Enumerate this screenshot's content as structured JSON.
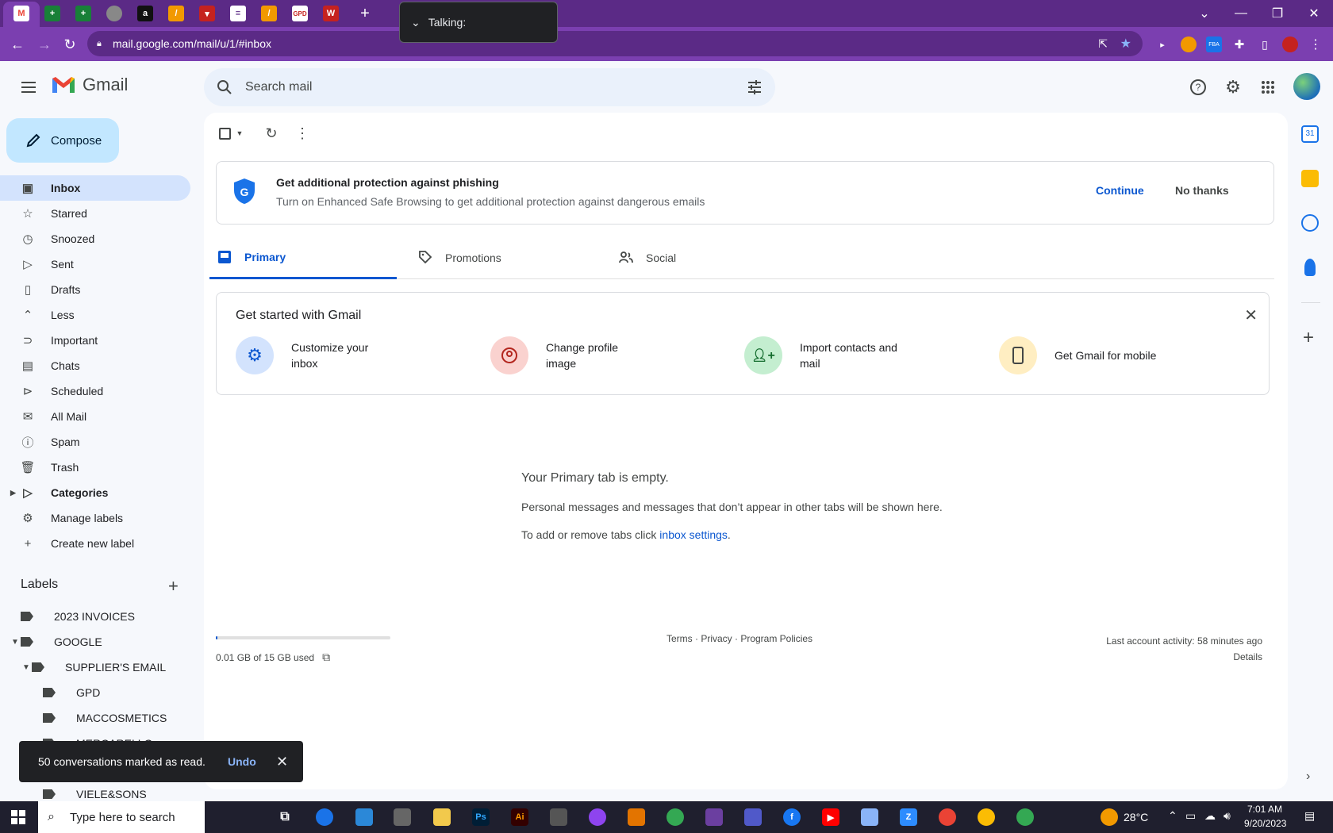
{
  "browser": {
    "url": "mail.google.com/mail/u/1/#inbox",
    "talking_label": "Talking:"
  },
  "header": {
    "app_name": "Gmail",
    "search_placeholder": "Search mail"
  },
  "sidebar": {
    "compose_label": "Compose",
    "items": [
      {
        "label": "Inbox",
        "icon": "inbox-icon"
      },
      {
        "label": "Starred",
        "icon": "star-icon"
      },
      {
        "label": "Snoozed",
        "icon": "clock-icon"
      },
      {
        "label": "Sent",
        "icon": "send-icon"
      },
      {
        "label": "Drafts",
        "icon": "draft-icon"
      },
      {
        "label": "Less",
        "icon": "chevron-up-icon"
      },
      {
        "label": "Important",
        "icon": "important-icon"
      },
      {
        "label": "Chats",
        "icon": "chat-icon"
      },
      {
        "label": "Scheduled",
        "icon": "scheduled-icon"
      },
      {
        "label": "All Mail",
        "icon": "all-mail-icon"
      },
      {
        "label": "Spam",
        "icon": "spam-icon"
      },
      {
        "label": "Trash",
        "icon": "trash-icon"
      },
      {
        "label": "Categories",
        "icon": "label-icon"
      },
      {
        "label": "Manage labels",
        "icon": "gear-icon"
      },
      {
        "label": "Create new label",
        "icon": "plus-icon"
      }
    ],
    "labels_heading": "Labels",
    "labels": [
      "2023 INVOICES",
      "GOOGLE",
      "SUPPLIER'S EMAIL",
      "GPD",
      "MACCOSMETICS",
      "MERCARELLO",
      "VIELE&SONS"
    ]
  },
  "phishing": {
    "title": "Get additional protection against phishing",
    "subtitle": "Turn on Enhanced Safe Browsing to get additional protection against dangerous emails",
    "continue_label": "Continue",
    "no_thanks_label": "No thanks"
  },
  "tabs": [
    {
      "label": "Primary"
    },
    {
      "label": "Promotions"
    },
    {
      "label": "Social"
    }
  ],
  "get_started": {
    "title": "Get started with Gmail",
    "steps": [
      "Customize your inbox",
      "Change profile image",
      "Import contacts and mail",
      "Get Gmail for mobile"
    ]
  },
  "empty": {
    "title": "Your Primary tab is empty.",
    "line1": "Personal messages and messages that don’t appear in other tabs will be shown here.",
    "line2_prefix": "To add or remove tabs click ",
    "line2_link": "inbox settings",
    "line2_suffix": "."
  },
  "footer": {
    "storage": "0.01 GB of 15 GB used",
    "storage_fraction": 0.001,
    "links": "Terms · Privacy · Program Policies",
    "activity": "Last account activity: 58 minutes ago",
    "details": "Details"
  },
  "snackbar": {
    "message": "50 conversations marked as read.",
    "undo_label": "Undo"
  },
  "taskbar": {
    "search_placeholder": "Type here to search",
    "weather": "28°C",
    "time": "7:01 AM",
    "date": "9/20/2023"
  },
  "colors": {
    "browser_frame": "#5b2a86",
    "accent": "#0b57d0",
    "compose_bg": "#c2e7ff",
    "active_nav": "#d3e3fd"
  }
}
